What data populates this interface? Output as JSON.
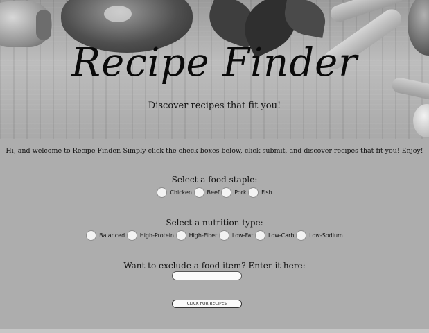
{
  "header": {
    "title": "Recipe Finder",
    "subtitle": "Discover recipes that fit you!"
  },
  "intro": "Hi, and welcome to Recipe Finder. Simply click the check boxes below, click submit, and discover recipes that fit you! Enjoy!",
  "food_staple": {
    "heading": "Select a food staple:",
    "options": [
      "Chicken",
      "Beef",
      "Pork",
      "Fish"
    ]
  },
  "nutrition": {
    "heading": "Select a nutrition type:",
    "options": [
      "Balanced",
      "High-Protein",
      "High-Fiber",
      "Low-Fat",
      "Low-Carb",
      "Low-Sodium"
    ]
  },
  "exclude": {
    "heading": "Want to exclude a food item? Enter it here:",
    "value": "",
    "placeholder": ""
  },
  "submit_label": "CLICK FOR RECIPES"
}
